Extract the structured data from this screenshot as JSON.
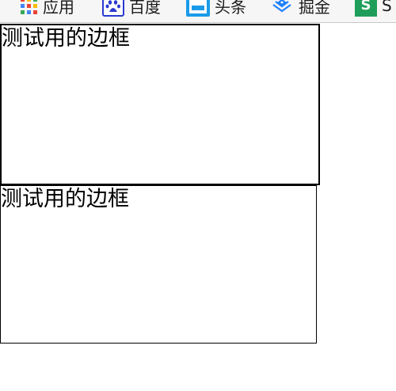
{
  "bookmarks_bar": {
    "items": [
      {
        "label": "应用",
        "icon": "apps-grid-icon"
      },
      {
        "label": "百度",
        "icon": "baidu-paw-icon"
      },
      {
        "label": "头条",
        "icon": "toutiao-icon"
      },
      {
        "label": "掘金",
        "icon": "juejin-icon"
      },
      {
        "label": "S",
        "icon": "segmentfault-icon"
      }
    ]
  },
  "main": {
    "box_1": {
      "text": "测试用的边框"
    },
    "box_2": {
      "text": "测试用的边框"
    }
  },
  "colors": {
    "bar_background": "#f6f6f6",
    "baidu_blue": "#2a3ad0",
    "toutiao_blue": "#1a9be8",
    "juejin_blue": "#1e80ff",
    "sf_green": "#1e9e5a",
    "border": "#000000"
  }
}
